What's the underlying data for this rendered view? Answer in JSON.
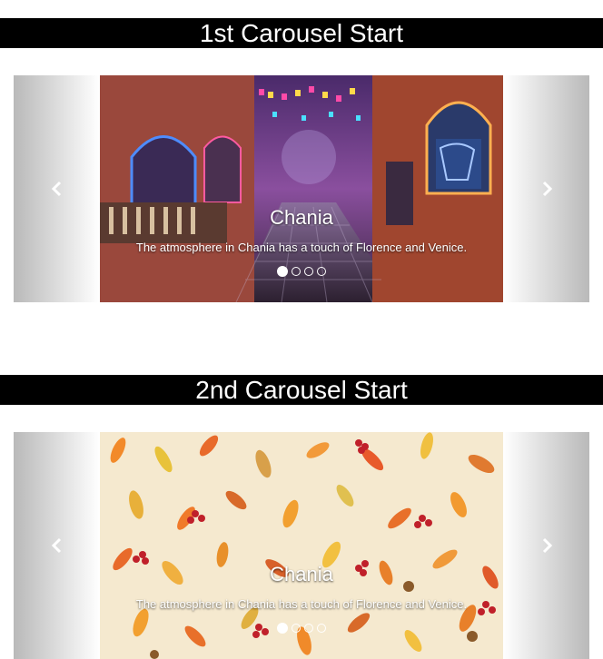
{
  "sections": [
    {
      "header": "1st Carousel Start",
      "slide": {
        "title": "Chania",
        "text": "The atmosphere in Chania has a touch of Florence and Venice.",
        "image": "festive-cobblestone-street-night"
      },
      "indicators": {
        "count": 4,
        "active": 0
      }
    },
    {
      "header": "2nd Carousel Start",
      "slide": {
        "title": "Chania",
        "text": "The atmosphere in Chania has a touch of Florence and Venice.",
        "image": "autumn-leaves-berries-pattern"
      },
      "indicators": {
        "count": 4,
        "active": 0
      }
    }
  ],
  "controls": {
    "prev_icon": "chevron-left-icon",
    "next_icon": "chevron-right-icon"
  },
  "colors": {
    "header_bg": "#000000",
    "header_text": "#ffffff",
    "control_gradient_edge": "#b9b9b9",
    "caption_text": "#ffffff",
    "slide1_sky": "#7a3d88",
    "slide2_background": "#f5e9cf"
  }
}
